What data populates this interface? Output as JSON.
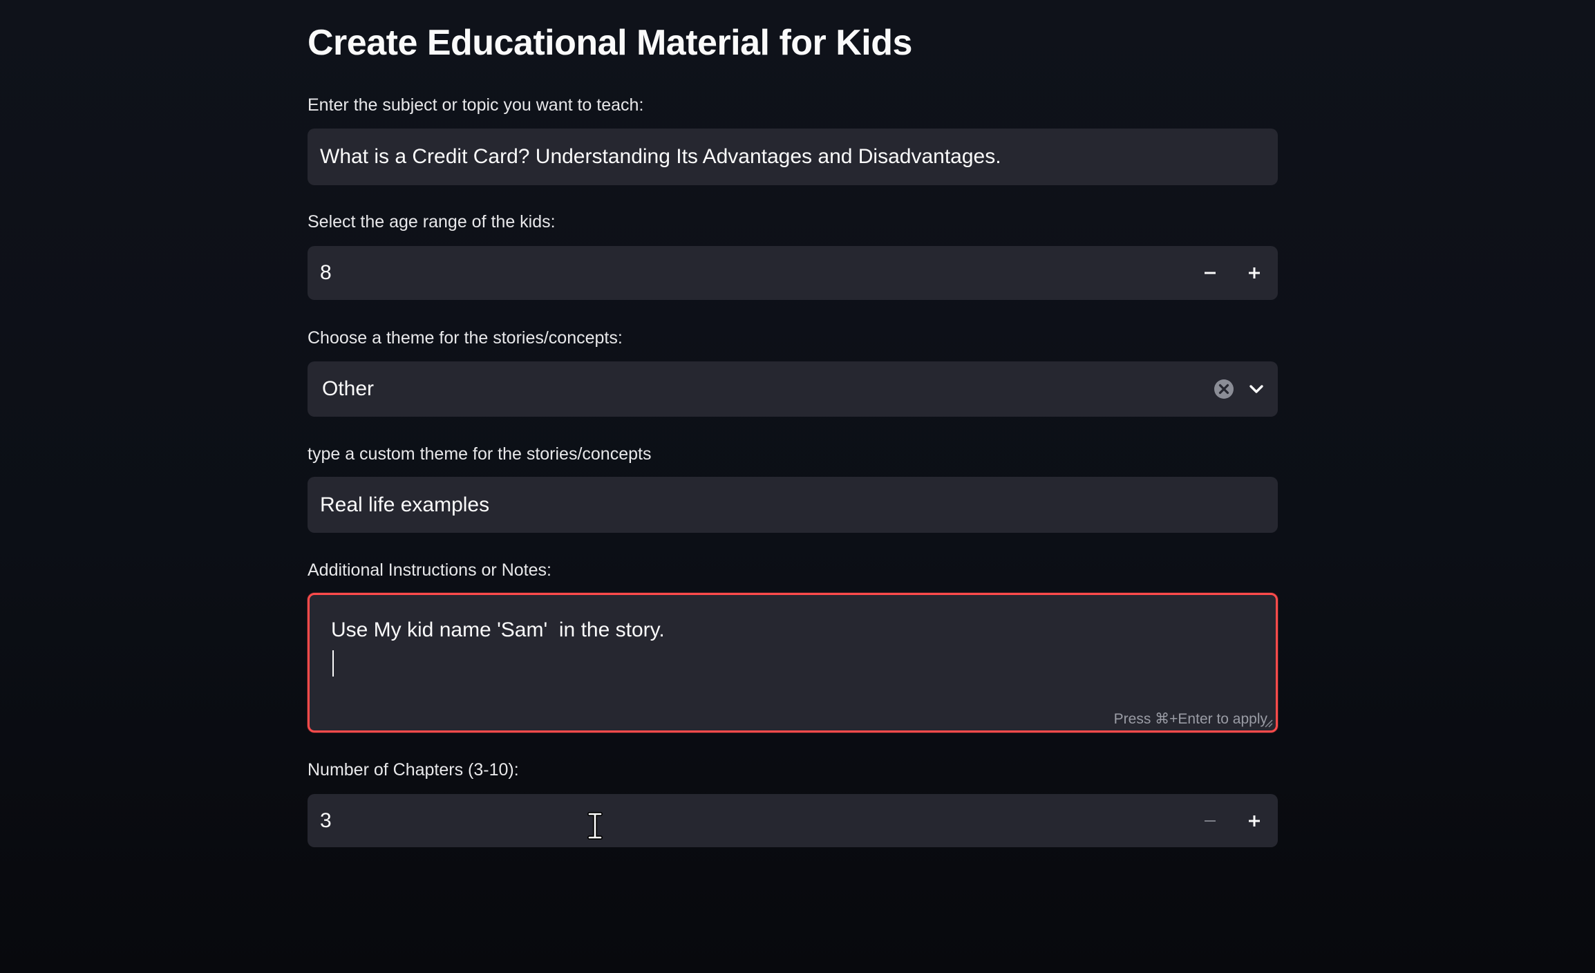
{
  "form": {
    "title": "Create Educational Material for Kids",
    "topic": {
      "label": "Enter the subject or topic you want to teach:",
      "value": "What is a Credit Card? Understanding Its Advantages and Disadvantages."
    },
    "age": {
      "label": "Select the age range of the kids:",
      "value": "8",
      "decrement": "−",
      "increment": "+"
    },
    "theme": {
      "label": "Choose a theme for the stories/concepts:",
      "selected": "Other"
    },
    "custom_theme": {
      "label": "type a custom theme for the stories/concepts",
      "value": "Real life examples"
    },
    "notes": {
      "label": "Additional Instructions or Notes:",
      "value": "Use My kid name 'Sam'  in the story.",
      "hint": "Press ⌘+Enter to apply"
    },
    "chapters": {
      "label": "Number of Chapters (3-10):",
      "value": "3",
      "decrement": "−",
      "increment": "+"
    }
  },
  "colors": {
    "background": "#0e1117",
    "field": "#262730",
    "focus_border": "#ff4b4b",
    "text": "#fafafa"
  },
  "icons": {
    "clear": "clear-icon",
    "dropdown": "chevron-down-icon",
    "cursor": "text-cursor-icon"
  }
}
